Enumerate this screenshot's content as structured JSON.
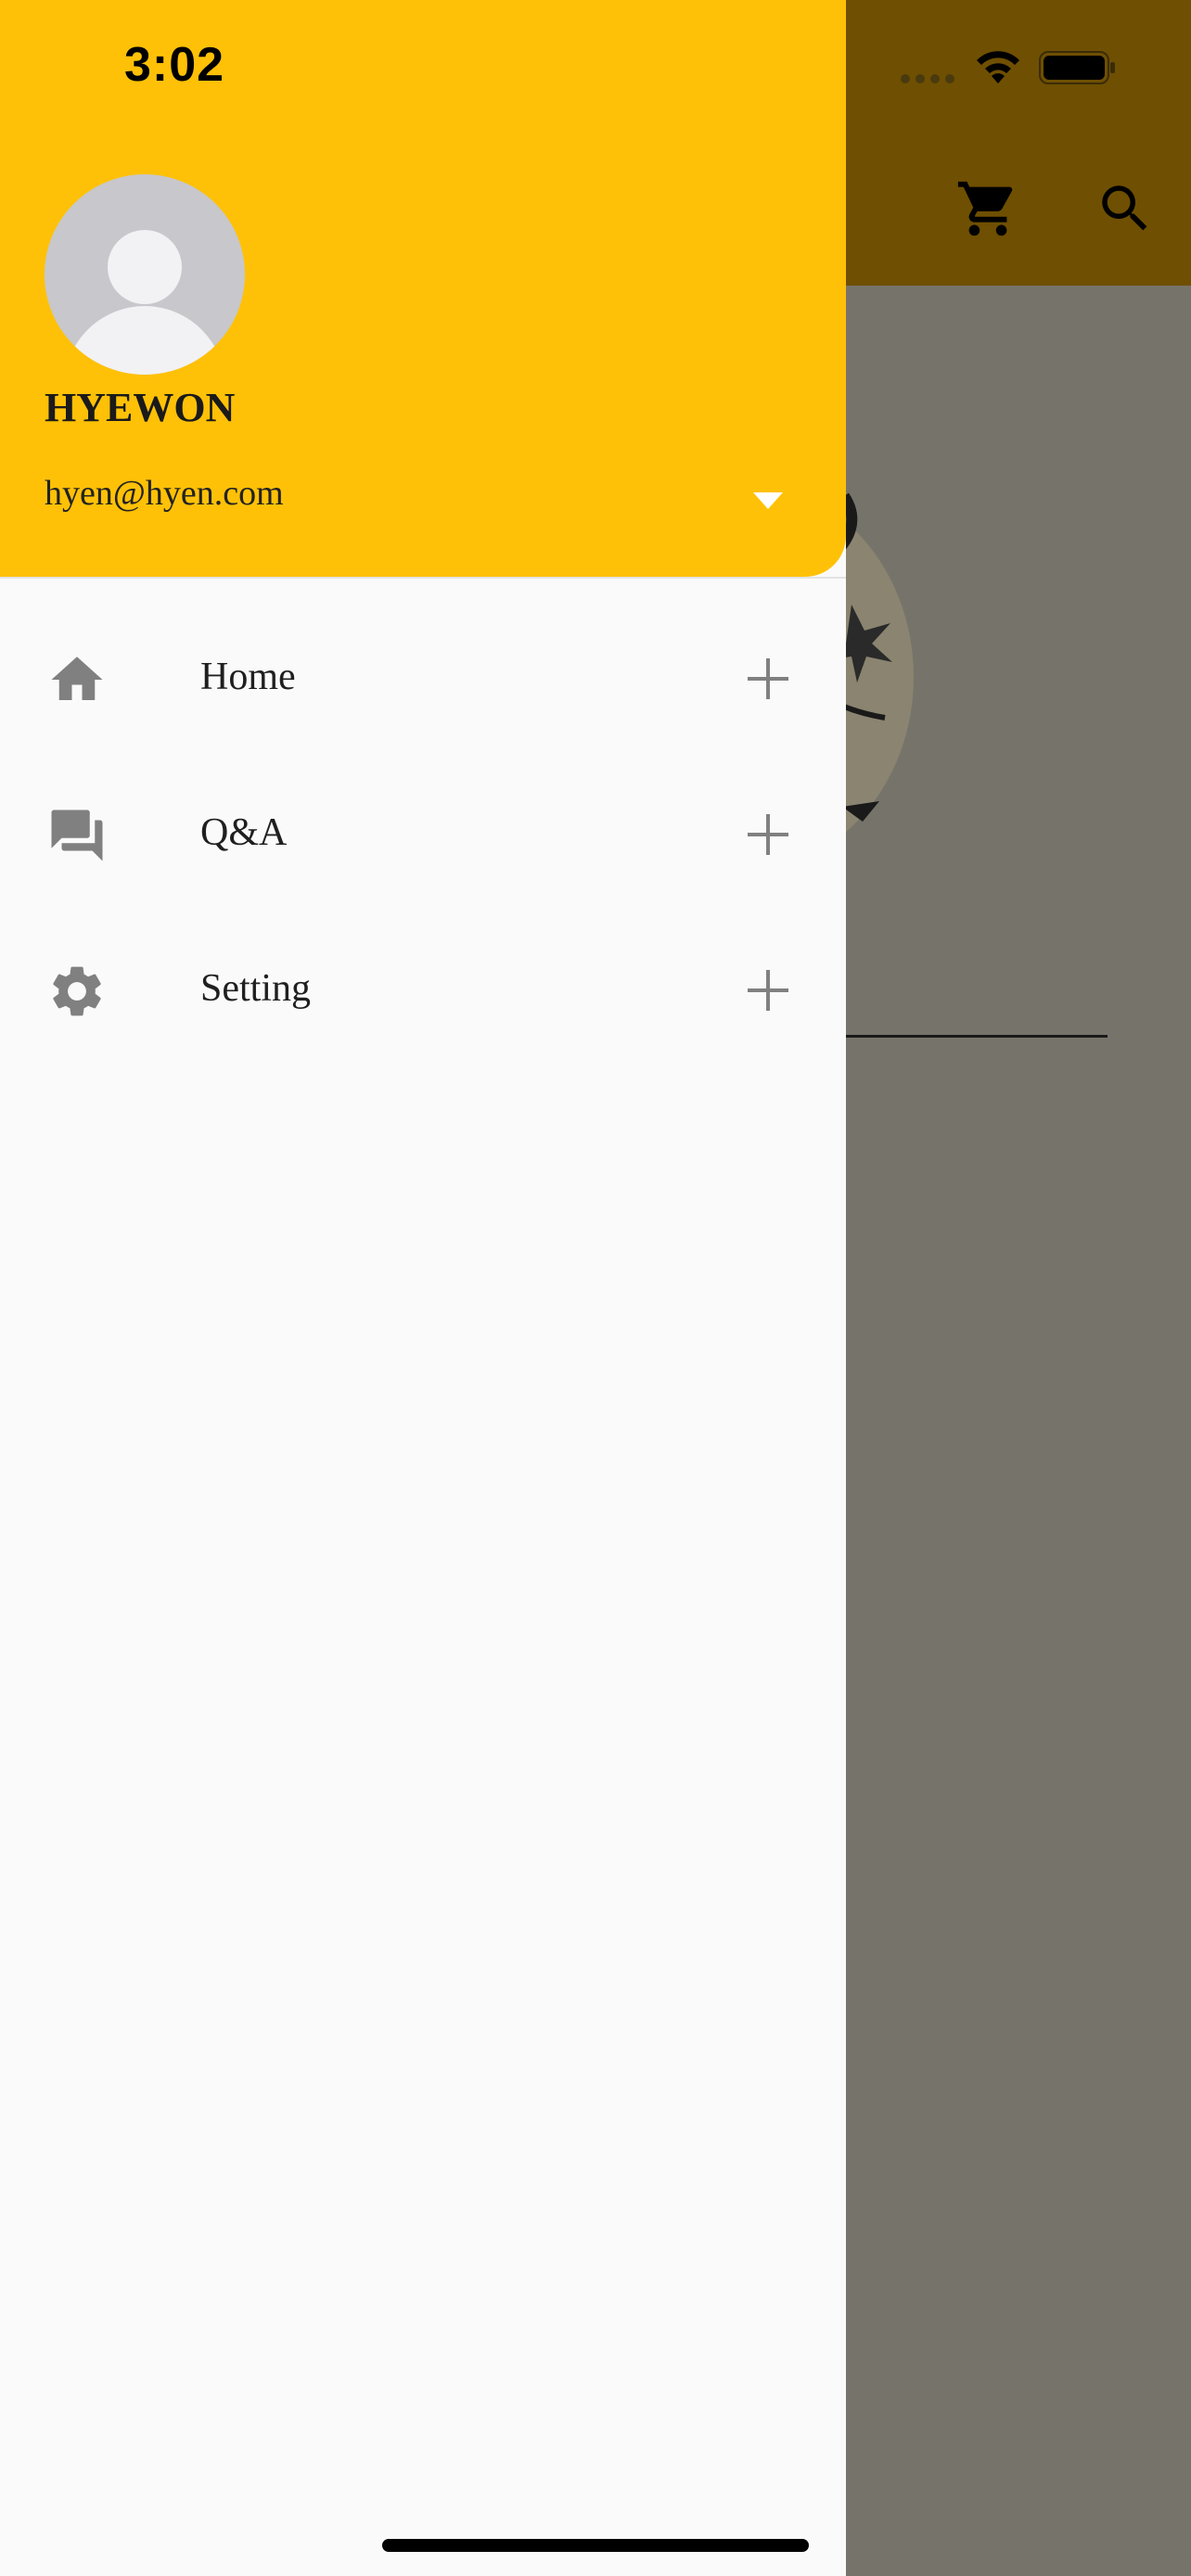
{
  "status_bar": {
    "time": "3:02"
  },
  "background_app": {
    "icons": [
      "cart-icon",
      "search-icon"
    ]
  },
  "drawer": {
    "header": {
      "name": "HYEWON",
      "email": "hyen@hyen.com"
    },
    "items": [
      {
        "label": "Home",
        "icon": "home-icon"
      },
      {
        "label": "Q&A",
        "icon": "forum-icon"
      },
      {
        "label": "Setting",
        "icon": "settings-icon"
      }
    ]
  },
  "colors": {
    "header": "#ffc107",
    "scrim_appbar": "#6f4f01",
    "scrim_body": "#76746a",
    "icon_gray": "#808080"
  }
}
